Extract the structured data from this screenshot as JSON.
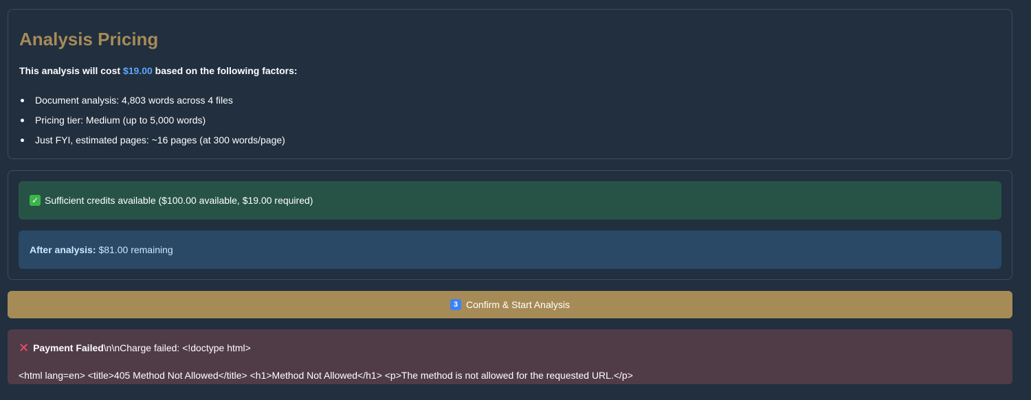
{
  "pricing": {
    "title": "Analysis Pricing",
    "summary_prefix": "This analysis will cost ",
    "cost": "$19.00",
    "summary_suffix": " based on the following factors:",
    "factors": [
      "Document analysis: 4,803 words across 4 files",
      "Pricing tier: Medium (up to 5,000 words)",
      "Just FYI, estimated pages: ~16 pages (at 300 words/page)"
    ]
  },
  "credits": {
    "success_icon": "check-icon",
    "success_text": "Sufficient credits available ($100.00 available, $19.00 required)",
    "after_label": "After analysis:",
    "after_value": "$81.00 remaining"
  },
  "confirm": {
    "icon_text": "3",
    "label": "Confirm & Start Analysis"
  },
  "error": {
    "icon": "x-icon",
    "title": "Payment Failed",
    "line1_rest": "\\n\\nCharge failed: <!doctype html>",
    "line2": "<html lang=en> <title>405 Method Not Allowed</title> <h1>Method Not Allowed</h1> <p>The method is not allowed for the requested URL.</p>"
  },
  "colors": {
    "background": "#212f3f",
    "accent": "#a78b57",
    "cost": "#60a5fa",
    "success_bg": "#275347",
    "info_bg": "#294966",
    "error_bg": "#503c47"
  }
}
